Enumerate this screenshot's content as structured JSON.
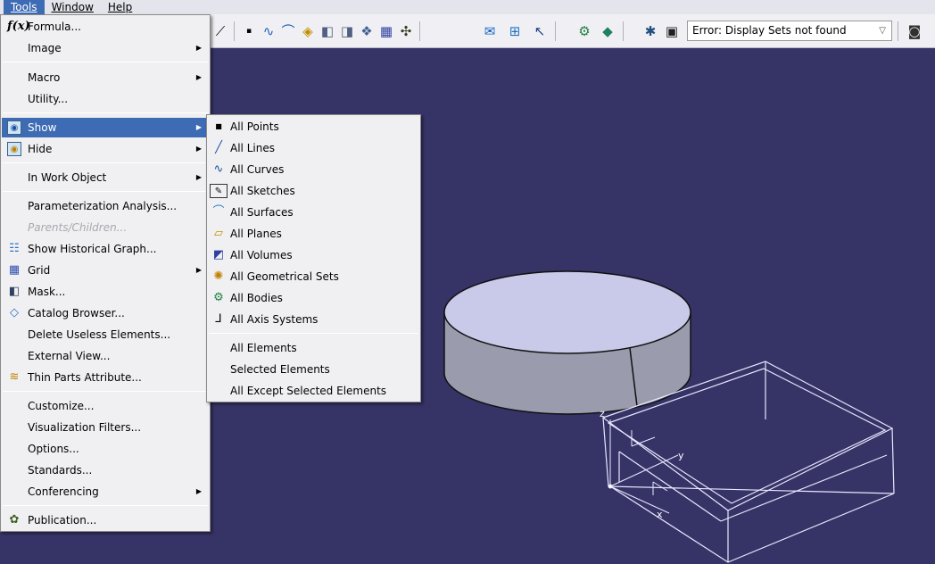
{
  "menubar": {
    "tools": "Tools",
    "window": "Window",
    "help": "Help"
  },
  "toolbar": {
    "display_set_value": "Error: Display Sets not found"
  },
  "tools_menu": {
    "items": [
      {
        "label": "Formula...",
        "icon": "formula-icon"
      },
      {
        "label": "Image",
        "submenu": true
      },
      {
        "label": "Macro",
        "submenu": true
      },
      {
        "label": "Utility..."
      },
      {
        "label": "Show",
        "submenu": true,
        "highlighted": true,
        "icon": "show-icon"
      },
      {
        "label": "Hide",
        "submenu": true,
        "icon": "hide-icon"
      },
      {
        "label": "In Work Object",
        "submenu": true
      },
      {
        "label": "Parameterization Analysis..."
      },
      {
        "label": "Parents/Children...",
        "disabled": true
      },
      {
        "label": "Show Historical Graph...",
        "icon": "historical-graph-icon"
      },
      {
        "label": "Grid",
        "submenu": true,
        "icon": "grid-icon"
      },
      {
        "label": "Mask...",
        "icon": "mask-icon"
      },
      {
        "label": "Catalog Browser...",
        "icon": "catalog-icon"
      },
      {
        "label": "Delete Useless Elements..."
      },
      {
        "label": "External View..."
      },
      {
        "label": "Thin Parts Attribute...",
        "icon": "thin-parts-icon"
      },
      {
        "label": "Customize..."
      },
      {
        "label": "Visualization Filters..."
      },
      {
        "label": "Options..."
      },
      {
        "label": "Standards..."
      },
      {
        "label": "Conferencing",
        "submenu": true
      },
      {
        "label": "Publication...",
        "icon": "publication-icon"
      }
    ]
  },
  "show_submenu": {
    "items": [
      {
        "label": "All Points",
        "icon": "point-icon"
      },
      {
        "label": "All Lines",
        "icon": "line-icon"
      },
      {
        "label": "All Curves",
        "icon": "curve-icon"
      },
      {
        "label": "All Sketches",
        "icon": "sketch-icon"
      },
      {
        "label": "All Surfaces",
        "icon": "surface-icon"
      },
      {
        "label": "All Planes",
        "icon": "plane-icon"
      },
      {
        "label": "All Volumes",
        "icon": "volume-icon"
      },
      {
        "label": "All Geometrical Sets",
        "icon": "geometrical-set-icon"
      },
      {
        "label": "All Bodies",
        "icon": "body-icon"
      },
      {
        "label": "All Axis Systems",
        "icon": "axis-system-icon"
      },
      {
        "label": "All Elements"
      },
      {
        "label": "Selected Elements"
      },
      {
        "label": "All Except Selected Elements"
      }
    ]
  },
  "axis_labels": {
    "z": "z",
    "y": "y",
    "x": "x"
  },
  "colors": {
    "viewport_bg": "#363366",
    "highlight": "#3d6bb4",
    "cylinder_top": "#c8c8e8",
    "cylinder_side": "#9c9cae",
    "wireframe": "#ffffff"
  }
}
